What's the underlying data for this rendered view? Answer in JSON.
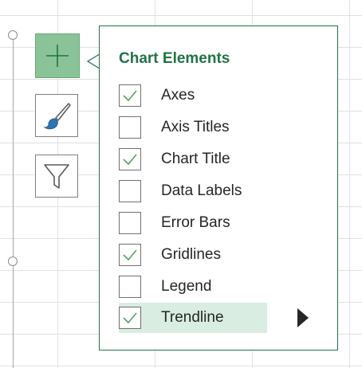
{
  "colors": {
    "accent": "#217346",
    "plus_button": "#8bc398",
    "selected_row": "#d9ede2",
    "checkmark": "#5ba46b"
  },
  "side_buttons": [
    {
      "name": "chart-elements",
      "icon": "plus-icon",
      "active": true
    },
    {
      "name": "chart-styles",
      "icon": "paintbrush-icon",
      "active": false
    },
    {
      "name": "chart-filters",
      "icon": "funnel-icon",
      "active": false
    }
  ],
  "flyout": {
    "title": "Chart Elements",
    "items": [
      {
        "label": "Axes",
        "checked": true
      },
      {
        "label": "Axis Titles",
        "checked": false
      },
      {
        "label": "Chart Title",
        "checked": true
      },
      {
        "label": "Data Labels",
        "checked": false
      },
      {
        "label": "Error Bars",
        "checked": false
      },
      {
        "label": "Gridlines",
        "checked": true
      },
      {
        "label": "Legend",
        "checked": false
      },
      {
        "label": "Trendline",
        "checked": true,
        "selected": true,
        "has_submenu": true
      }
    ]
  }
}
